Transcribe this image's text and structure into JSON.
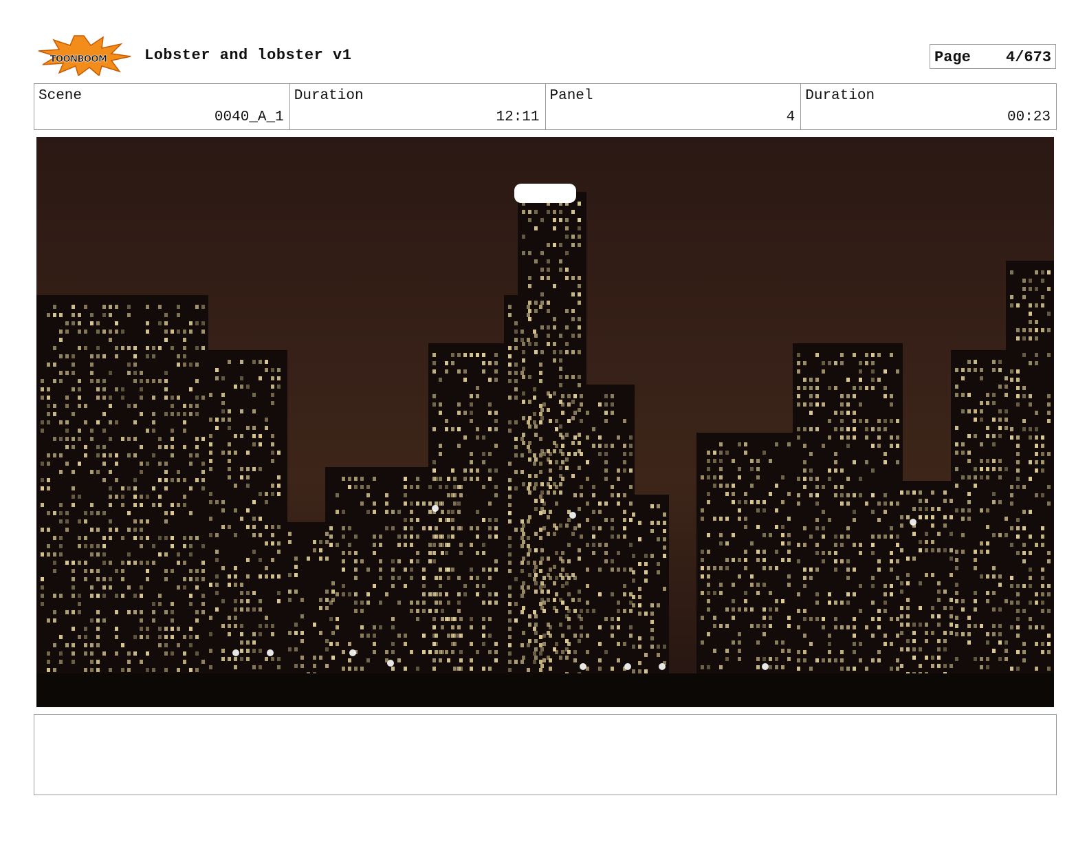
{
  "header": {
    "logo_text": "TOONBOOM",
    "title": "Lobster and lobster v1",
    "page_label": "Page",
    "page_value": "4/673"
  },
  "info": {
    "scene_label": "Scene",
    "scene_value": "0040_A_1",
    "scene_duration_label": "Duration",
    "scene_duration_value": "12:11",
    "panel_label": "Panel",
    "panel_value": "4",
    "panel_duration_label": "Duration",
    "panel_duration_value": "00:23"
  },
  "panel_image": {
    "subject": "night-city-skyline-photo",
    "colors": {
      "sky": "#3a221a",
      "building": "#120b09",
      "window": "#e9d79a",
      "glow": "#ffffff"
    }
  },
  "notes": {
    "text": ""
  }
}
